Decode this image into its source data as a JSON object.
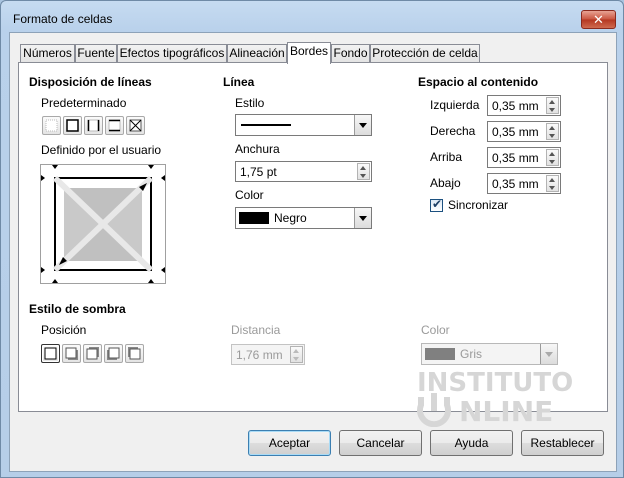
{
  "window": {
    "title": "Formato de celdas",
    "close_glyph": "✕"
  },
  "tabs": [
    {
      "label": "Números"
    },
    {
      "label": "Fuente"
    },
    {
      "label": "Efectos tipográficos"
    },
    {
      "label": "Alineación"
    },
    {
      "label": "Bordes",
      "active": true
    },
    {
      "label": "Fondo"
    },
    {
      "label": "Protección de celda"
    }
  ],
  "line_arrangement": {
    "heading": "Disposición de líneas",
    "default_label": "Predeterminado",
    "user_defined_label": "Definido por el usuario"
  },
  "line": {
    "heading": "Línea",
    "style_label": "Estilo",
    "width_label": "Anchura",
    "width_value": "1,75 pt",
    "color_label": "Color",
    "color_value": "Negro",
    "color_swatch": "#000000"
  },
  "padding": {
    "heading": "Espacio al contenido",
    "left_label": "Izquierda",
    "left_value": "0,35 mm",
    "right_label": "Derecha",
    "right_value": "0,35 mm",
    "top_label": "Arriba",
    "top_value": "0,35 mm",
    "bottom_label": "Abajo",
    "bottom_value": "0,35 mm",
    "sync_label": "Sincronizar",
    "sync_checked": true
  },
  "shadow": {
    "heading": "Estilo de sombra",
    "position_label": "Posición",
    "distance_label": "Distancia",
    "distance_value": "1,76 mm",
    "color_label": "Color",
    "color_value": "Gris",
    "color_swatch": "#808080"
  },
  "watermark": {
    "line1": "INSTITUTO",
    "line2": "NLINE"
  },
  "buttons": {
    "ok": "Aceptar",
    "cancel": "Cancelar",
    "help": "Ayuda",
    "reset": "Restablecer"
  }
}
